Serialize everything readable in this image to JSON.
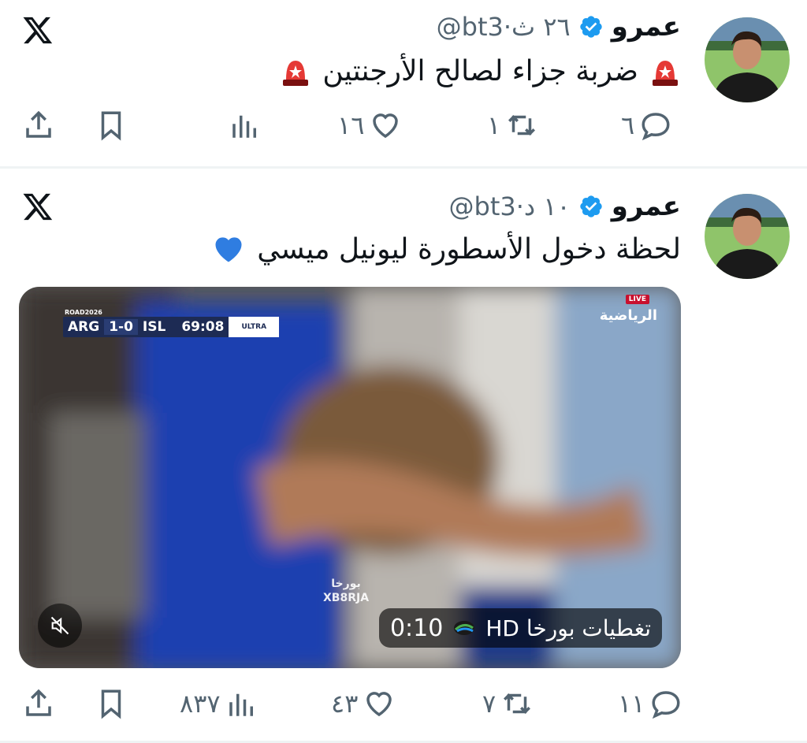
{
  "tweets": [
    {
      "name": "عمرو",
      "handle": "@bt3",
      "separator": "·",
      "time": "٢٦ ث",
      "text": "ضربة جزاء لصالح الأرجنتين",
      "emoji_icon": "police-light-icon",
      "actions": {
        "replies": "٦",
        "retweets": "١",
        "likes": "١٦",
        "views": ""
      }
    },
    {
      "name": "عمرو",
      "handle": "@bt3",
      "separator": "·",
      "time": "١٠ د",
      "text": "لحظة دخول الأسطورة ليونيل ميسي",
      "emoji_icon": "blue-heart-icon",
      "actions": {
        "replies": "١١",
        "retweets": "٧",
        "likes": "٤٣",
        "views": "٨٣٧"
      },
      "media": {
        "scoreboard": {
          "home": "ARG",
          "score": "1-0",
          "away": "ISL",
          "clock": "69:08",
          "badge": "ULTRA",
          "tag": "ROAD2026"
        },
        "channel": "الرياضية",
        "live": "LIVE",
        "watermark_top": "بورخا",
        "watermark_bottom": "XB8RJA",
        "duration": "0:10",
        "caption": "تغطيات بورخا HD"
      }
    }
  ],
  "colors": {
    "verified": "#1d9bf0",
    "muted_text": "#536471",
    "text": "#0f1419"
  }
}
